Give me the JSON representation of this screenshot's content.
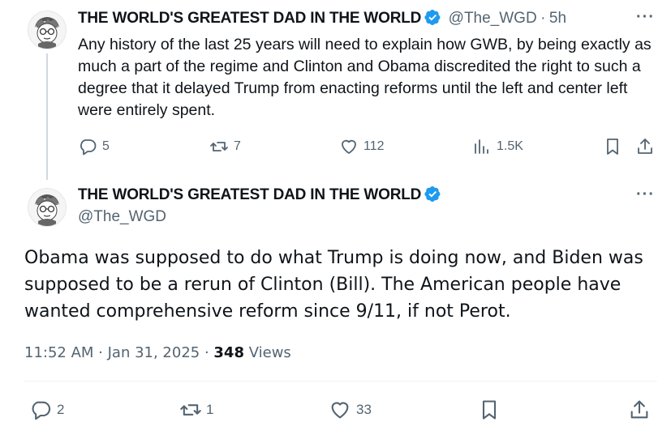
{
  "reply_tweet": {
    "display_name": "THE WORLD'S GREATEST DAD IN THE WORLD",
    "handle": "@The_WGD",
    "separator": "·",
    "time_ago": "5h",
    "text": "Any history of the last 25 years will need to explain how GWB, by being exactly as much a part of the regime and Clinton and Obama discredited the right to such a degree that it delayed Trump from enacting reforms until the left and center left were entirely spent.",
    "actions": {
      "replies": "5",
      "reposts": "7",
      "likes": "112",
      "views": "1.5K"
    }
  },
  "main_tweet": {
    "display_name": "THE WORLD'S GREATEST DAD IN THE WORLD",
    "handle": "@The_WGD",
    "text": "Obama was supposed to do what Trump is doing now, and Biden was supposed to be a rerun of Clinton (Bill). The American people have wanted comprehensive reform since 9/11, if not Perot.",
    "timestamp": "11:52 AM · Jan 31, 2025 · ",
    "views_count": "348",
    "views_label": "Views",
    "actions": {
      "replies": "2",
      "reposts": "1",
      "likes": "33"
    }
  },
  "more_label": "···",
  "colors": {
    "verified": "#1d9bf0",
    "secondary_text": "#536471",
    "primary_text": "#0f1419"
  }
}
